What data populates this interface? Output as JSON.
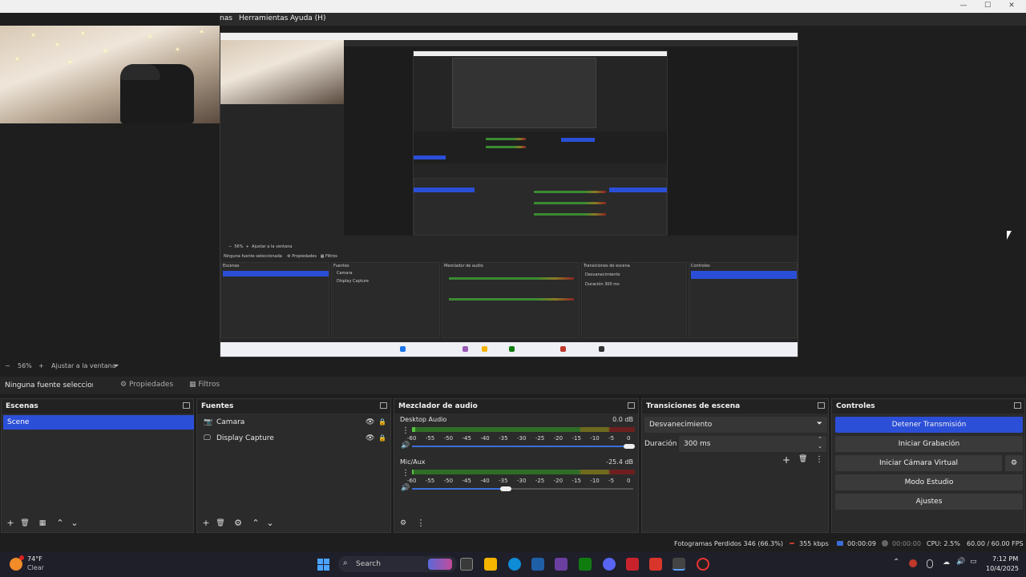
{
  "titlebar": {
    "minimize": "—",
    "maximize": "☐",
    "close": "✕"
  },
  "menubar": {
    "items": [
      "nas",
      "Herramientas",
      "Ayuda (H)"
    ]
  },
  "zoombar": {
    "minus": "−",
    "zoom": "56%",
    "plus": "+",
    "fit": "Ajustar a la ventana"
  },
  "context": {
    "no_source": "Ninguna fuente seleccionada",
    "properties": "Propiedades",
    "filters": "Filtros"
  },
  "scenes": {
    "title": "Escenas",
    "items": [
      "Scene"
    ]
  },
  "sources": {
    "title": "Fuentes",
    "items": [
      "Camara",
      "Display Capture"
    ]
  },
  "mixer": {
    "title": "Mezclador de audio",
    "channels": [
      {
        "name": "Desktop Audio",
        "db": "0.0 dB"
      },
      {
        "name": "Mic/Aux",
        "db": "-25.4 dB"
      }
    ],
    "ticks": [
      "-60",
      "-55",
      "-50",
      "-45",
      "-40",
      "-35",
      "-30",
      "-25",
      "-20",
      "-15",
      "-10",
      "-5",
      "0"
    ]
  },
  "transitions": {
    "title": "Transiciones de escena",
    "selected": "Desvanecimiento",
    "duration_label": "Duración",
    "duration_value": "300 ms"
  },
  "controls": {
    "title": "Controles",
    "stop_stream": "Detener Transmisión",
    "start_recording": "Iniciar Grabación",
    "start_virtual_cam": "Iniciar Cámara Virtual",
    "studio_mode": "Modo Estudio",
    "settings": "Ajustes"
  },
  "status": {
    "dropped": "Fotogramas Perdidos 346 (66.3%)",
    "bitrate": "355 kbps",
    "stream_time": "00:00:09",
    "rec_time": "00:00:00",
    "cpu": "CPU: 2.5%",
    "fps": "60.00 / 60.00 FPS"
  },
  "taskbar": {
    "weather_temp": "74°F",
    "weather_desc": "Clear",
    "search": "Search",
    "time": "7:12 PM",
    "date": "10/4/2025"
  },
  "colors": {
    "accent": "#2c4fd8",
    "panel": "#2b2b2b",
    "background": "#1e1e1e"
  },
  "icons": {
    "eye": "👁",
    "lock": "🔒",
    "camera": "📷",
    "monitor": "🖵",
    "gear": "⚙",
    "add": "+",
    "trash": "🗑",
    "filter": "▦",
    "up": "⌃",
    "down": "⌄",
    "more": "⋮",
    "speaker": "🔊"
  }
}
